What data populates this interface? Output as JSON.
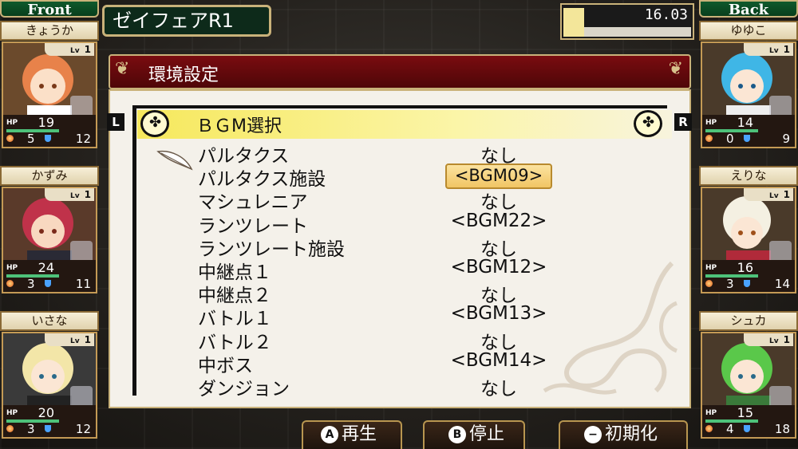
{
  "top": {
    "location": "ゼイフェアR1",
    "timer": "16.03"
  },
  "party_front": {
    "header": "Front",
    "members": [
      {
        "name": "きょうか",
        "lv_label": "Lv",
        "lv": "1",
        "hp_label": "HP",
        "hp": "19",
        "orb": "5",
        "shield": "12"
      },
      {
        "name": "かずみ",
        "lv_label": "Lv",
        "lv": "1",
        "hp_label": "HP",
        "hp": "24",
        "orb": "3",
        "shield": "11"
      },
      {
        "name": "いさな",
        "lv_label": "Lv",
        "lv": "1",
        "hp_label": "HP",
        "hp": "20",
        "orb": "3",
        "shield": "12"
      }
    ]
  },
  "party_back": {
    "header": "Back",
    "members": [
      {
        "name": "ゆゆこ",
        "lv_label": "Lv",
        "lv": "1",
        "hp_label": "HP",
        "hp": "14",
        "orb": "0",
        "shield": "9"
      },
      {
        "name": "えりな",
        "lv_label": "Lv",
        "lv": "1",
        "hp_label": "HP",
        "hp": "16",
        "orb": "3",
        "shield": "14"
      },
      {
        "name": "シュカ",
        "lv_label": "Lv",
        "lv": "1",
        "hp_label": "HP",
        "hp": "15",
        "orb": "4",
        "shield": "18"
      }
    ]
  },
  "panel": {
    "title": "環境設定",
    "l_key": "L",
    "r_key": "R",
    "section_title": "ＢＧM選択",
    "rows": [
      {
        "label": "パルタクス",
        "value": "なし",
        "selected": false
      },
      {
        "label": "パルタクス施設",
        "value": "<BGM09>",
        "selected": true
      },
      {
        "label": "マシュレニア",
        "value": "なし",
        "selected": false
      },
      {
        "label": "ランツレート",
        "value": "<BGM22>",
        "selected": false
      },
      {
        "label": "ランツレート施設",
        "value": "なし",
        "selected": false
      },
      {
        "label": "中継点１",
        "value": "<BGM12>",
        "selected": false
      },
      {
        "label": "中継点２",
        "value": "なし",
        "selected": false
      },
      {
        "label": "バトル１",
        "value": "<BGM13>",
        "selected": false
      },
      {
        "label": "バトル２",
        "value": "なし",
        "selected": false
      },
      {
        "label": "中ボス",
        "value": "<BGM14>",
        "selected": false
      },
      {
        "label": "ダンジョン",
        "value": "なし",
        "selected": false
      }
    ]
  },
  "buttons": {
    "play": {
      "key": "A",
      "label": "再生"
    },
    "stop": {
      "key": "B",
      "label": "停止"
    },
    "reset": {
      "key": "−",
      "label": "初期化"
    }
  },
  "colors": {
    "accent_gold": "#c9b27a",
    "header_red": "#7a0c10",
    "highlight_yellow": "#f6e85c"
  }
}
